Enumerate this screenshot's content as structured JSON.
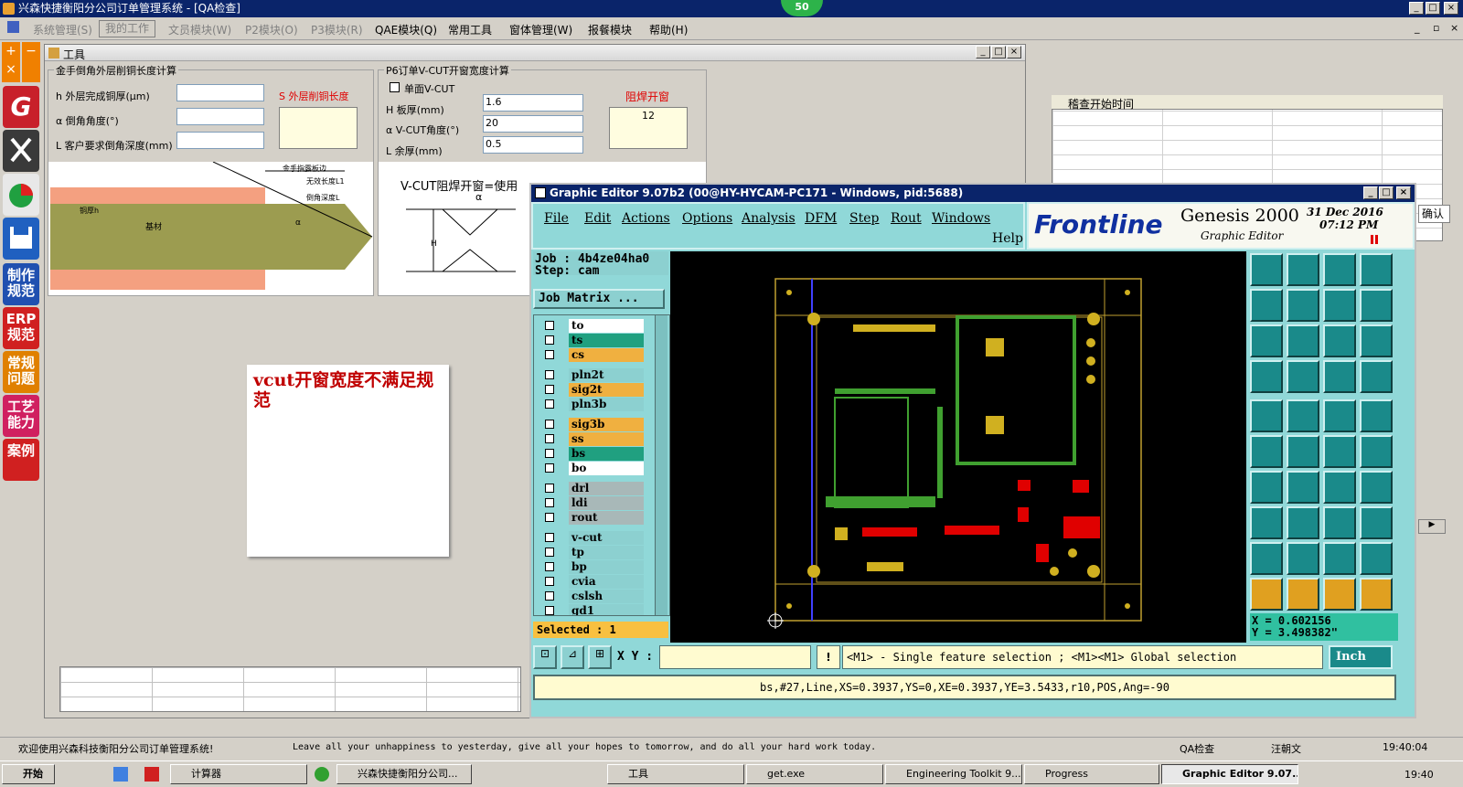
{
  "app": {
    "title": "兴森快捷衡阳分公司订单管理系统 - [QA检查]",
    "badge": "50",
    "menu": [
      "系统管理(S)",
      "我的工作",
      "文员模块(W)",
      "P2模块(O)",
      "P3模块(R)",
      "QAE模块(Q)",
      "常用工具",
      "窗体管理(W)",
      "报餐模块",
      "帮助(H)"
    ]
  },
  "left_bar": [
    "G",
    "",
    "",
    "",
    "制作规范",
    "ERP规范",
    "常规问题",
    "工艺能力",
    "案例"
  ],
  "tool_window": {
    "title": "工具",
    "group1": {
      "title": "金手倒角外层削铜长度计算",
      "h_label": "h 外层完成铜厚(μm)",
      "a_label": "α 倒角角度(°)",
      "l_label": "L 客户要求倒角深度(mm)",
      "s_label": "S 外层削铜长度",
      "diagram": {
        "top1": "金手指露板边",
        "top2": "无效长度L1",
        "top3": "倒角深度L",
        "copper": "铜厚h",
        "base": "基材",
        "alpha": "α"
      }
    },
    "group2": {
      "title": "P6订单V-CUT开窗宽度计算",
      "single_label": "单面V-CUT",
      "h_label": "H 板厚(mm)",
      "h_value": "1.6",
      "a_label": "α V-CUT角度(°)",
      "a_value": "20",
      "l_label": "L 余厚(mm)",
      "l_value": "0.5",
      "mask_label": "阻焊开窗",
      "mask_value": "12",
      "formula": "V-CUT阻焊开窗=使用"
    }
  },
  "note": "vcut开窗宽度不满足规范",
  "right_panel": {
    "header": "稽查开始时间",
    "button": "确认"
  },
  "graphic_editor": {
    "title": "Graphic Editor 9.07b2 (00@HY-HYCAM-PC171 - Windows, pid:5688)",
    "menu": [
      "File",
      "Edit",
      "Actions",
      "Options",
      "Analysis",
      "DFM",
      "Step",
      "Rout",
      "Windows"
    ],
    "help": "Help",
    "brand": "Frontline",
    "product": "Genesis 2000",
    "subtitle": "Graphic Editor",
    "date": "31 Dec 2016",
    "time": "07:12 PM",
    "job": "Job : 4b4ze04ha0",
    "step": "Step: cam",
    "job_matrix": "Job Matrix ...",
    "layers": [
      {
        "name": "to",
        "color": "#ffffff"
      },
      {
        "name": "ts",
        "color": "#20a080"
      },
      {
        "name": "cs",
        "color": "#f0b040"
      },
      {
        "name": "pln2t",
        "color": "#8cd0d0"
      },
      {
        "name": "sig2t",
        "color": "#f0b040"
      },
      {
        "name": "pln3b",
        "color": "#8cd0d0"
      },
      {
        "name": "sig3b",
        "color": "#f0b040"
      },
      {
        "name": "ss",
        "color": "#f0b040"
      },
      {
        "name": "bs",
        "color": "#20a080"
      },
      {
        "name": "bo",
        "color": "#ffffff"
      },
      {
        "name": "drl",
        "color": "#a8b8b8"
      },
      {
        "name": "ldi",
        "color": "#a8b8b8"
      },
      {
        "name": "rout",
        "color": "#a8b8b8"
      },
      {
        "name": "v-cut",
        "color": "#8cd0d0"
      },
      {
        "name": "tp",
        "color": "#8cd0d0"
      },
      {
        "name": "bp",
        "color": "#8cd0d0"
      },
      {
        "name": "cvia",
        "color": "#8cd0d0"
      },
      {
        "name": "cslsh",
        "color": "#8cd0d0"
      },
      {
        "name": "gd1",
        "color": "#8cd0d0"
      }
    ],
    "selected": "Selected : 1",
    "xy_label": "X Y :",
    "hint": "<M1> - Single feature selection ; <M1><M1> Global selection",
    "unit": "Inch",
    "coord_x": "X = 0.602156",
    "coord_y": "Y = 3.498382\"",
    "feature": "bs,#27,Line,XS=0.3937,YS=0,XE=0.3937,YE=3.5433,r10,POS,Ang=-90"
  },
  "status_bar": {
    "welcome": "欢迎使用兴森科技衡阳分公司订单管理系统!",
    "motto": "Leave all your unhappiness to yesterday, give all your hopes to tomorrow, and do all your hard work today.",
    "module": "QA检查",
    "user": "汪朝文",
    "time": "19:40:04"
  },
  "taskbar": {
    "start": "开始",
    "tasks": [
      "计算器",
      "兴森快捷衡阳分公司...",
      "工具",
      "get.exe",
      "Engineering Toolkit 9....",
      "Progress",
      "Graphic Editor 9.07..."
    ],
    "clock": "19:40"
  }
}
